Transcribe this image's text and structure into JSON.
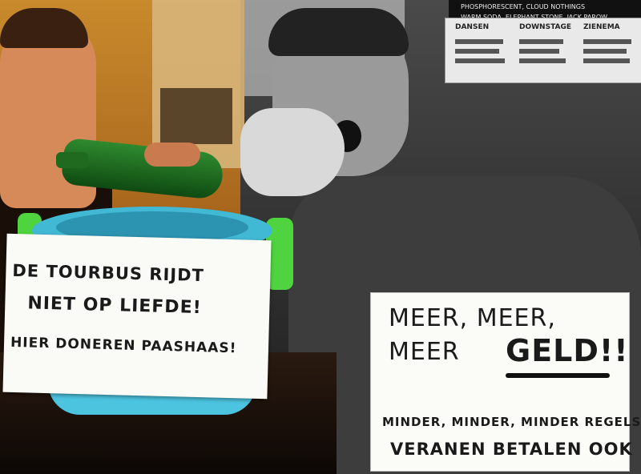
{
  "scene": {
    "description_colors": {
      "left_tint": "#c98a2c",
      "right_tint": "#3d3d3d",
      "cup_color": "#4cc3df",
      "cup_handle_color": "#4fd43f",
      "bottle_color": "#2f8a2f"
    }
  },
  "flyer": {
    "top_line_1": "PHOSPHORESCENT, CLOUD NOTHINGS",
    "top_line_2": "WARM SODA, ELEPHANT STONE, JACK PAROW",
    "heading_1": "DANSEN",
    "heading_2": "DOWNSTAGE",
    "heading_3": "ZIENEMA"
  },
  "signs": {
    "left": {
      "line1": "DE TOURBUS RIJDT",
      "line2": "NIET OP LIEFDE!",
      "line3": "HIER DONEREN PAASHAAS!"
    },
    "right": {
      "line1": "MEER, MEER,",
      "line2_prefix": "MEER",
      "line2_emphasis": "GELD!!",
      "line3": "MINDER, MINDER, MINDER REGELS",
      "line4": "VERANEN BETALEN OOK"
    }
  }
}
